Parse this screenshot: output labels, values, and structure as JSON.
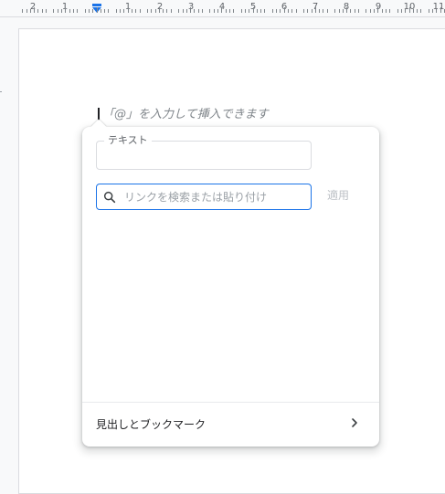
{
  "ruler": {
    "numbers": [
      "2",
      "1",
      "1",
      "2",
      "3",
      "4",
      "5",
      "6",
      "7",
      "8",
      "9",
      "10",
      "11"
    ]
  },
  "document": {
    "placeholder_hint": "「@」を入力して挿入できます"
  },
  "link_popup": {
    "text_field_label": "テキスト",
    "text_field_value": "",
    "search_placeholder": "リンクを検索または貼り付け",
    "search_value": "",
    "apply_label": "適用",
    "headings_bookmarks_label": "見出しとブックマーク"
  },
  "colors": {
    "accent": "#1a73e8",
    "apply_disabled": "#bdc1c6"
  },
  "icons": {
    "search": "search-icon",
    "chevron": "chevron-right-icon",
    "indent": "indent-marker-icon"
  }
}
